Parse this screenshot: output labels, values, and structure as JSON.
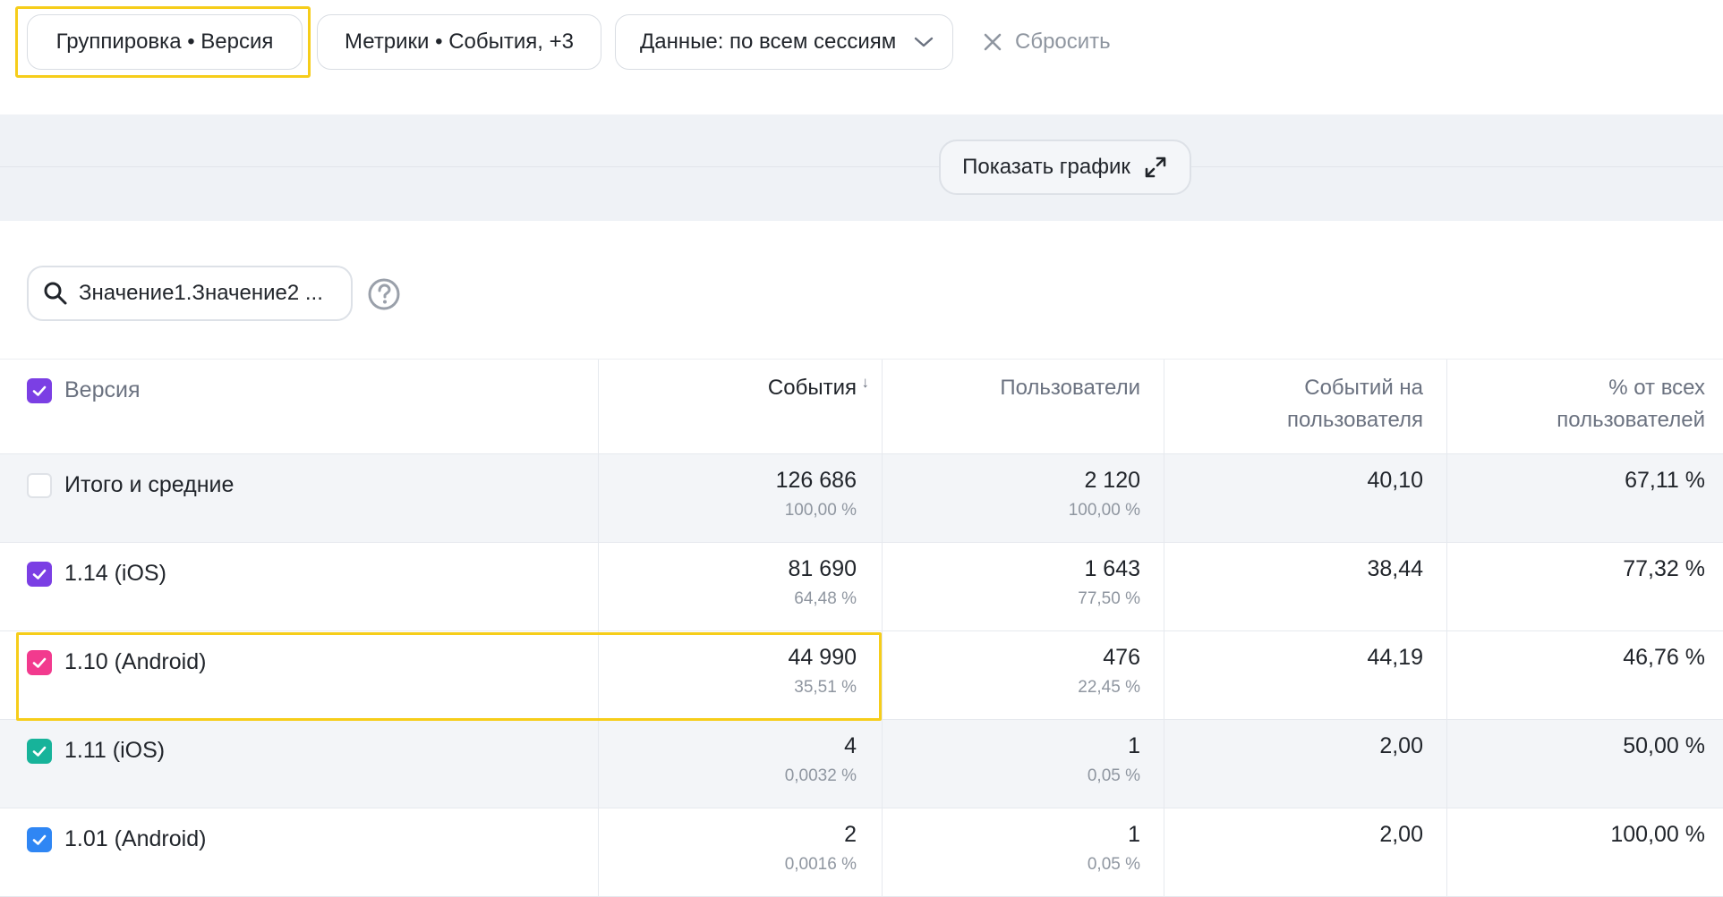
{
  "filters": {
    "grouping": "Группировка • Версия",
    "metrics": "Метрики • События, +3",
    "data_scope": "Данные: по всем сессиям",
    "reset": "Сбросить"
  },
  "chart": {
    "show_label": "Показать график"
  },
  "search": {
    "value": "Значение1.Значение2 ..."
  },
  "table": {
    "headers": {
      "version": "Версия",
      "events": "События",
      "sort_marker": "↓",
      "users": "Пользователи",
      "events_per_user_line1": "Событий на",
      "events_per_user_line2": "пользователя",
      "pct_users_line1": "% от всех",
      "pct_users_line2": "пользователей"
    },
    "rows": [
      {
        "name": "Итого и средние",
        "checked": false,
        "color": "#ffffff",
        "events": "126 686",
        "events_pct": "100,00 %",
        "users": "2 120",
        "users_pct": "100,00 %",
        "per_user": "40,10",
        "pct_all": "67,11 %"
      },
      {
        "name": "1.14 (iOS)",
        "checked": true,
        "color": "#7b3fe4",
        "events": "81 690",
        "events_pct": "64,48 %",
        "users": "1 643",
        "users_pct": "77,50 %",
        "per_user": "38,44",
        "pct_all": "77,32 %"
      },
      {
        "name": "1.10 (Android)",
        "checked": true,
        "color": "#f23a8e",
        "events": "44 990",
        "events_pct": "35,51 %",
        "users": "476",
        "users_pct": "22,45 %",
        "per_user": "44,19",
        "pct_all": "46,76 %"
      },
      {
        "name": "1.11 (iOS)",
        "checked": true,
        "color": "#17b39a",
        "events": "4",
        "events_pct": "0,0032 %",
        "users": "1",
        "users_pct": "0,05 %",
        "per_user": "2,00",
        "pct_all": "50,00 %"
      },
      {
        "name": "1.01 (Android)",
        "checked": true,
        "color": "#2f86f4",
        "events": "2",
        "events_pct": "0,0016 %",
        "users": "1",
        "users_pct": "0,05 %",
        "per_user": "2,00",
        "pct_all": "100,00 %"
      }
    ]
  },
  "colors": {
    "highlight": "#f6cd1a",
    "header_checkbox": "#7b3fe4"
  }
}
